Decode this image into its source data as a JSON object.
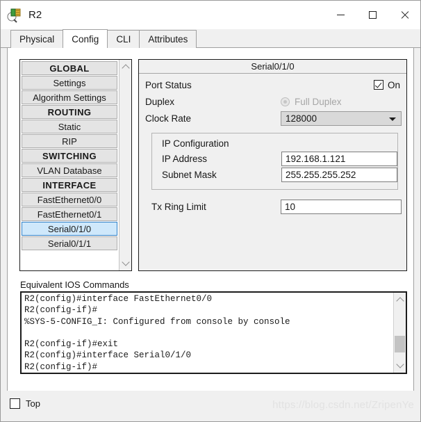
{
  "window": {
    "title": "R2",
    "icon": "packet-tracer-router-icon",
    "controls": {
      "minimize": "—",
      "maximize": "□",
      "close": "✕"
    }
  },
  "tabs": [
    {
      "label": "Physical",
      "active": false
    },
    {
      "label": "Config",
      "active": true
    },
    {
      "label": "CLI",
      "active": false
    },
    {
      "label": "Attributes",
      "active": false
    }
  ],
  "sidebar": {
    "items": [
      {
        "label": "GLOBAL",
        "type": "header"
      },
      {
        "label": "Settings",
        "type": "item"
      },
      {
        "label": "Algorithm Settings",
        "type": "item"
      },
      {
        "label": "ROUTING",
        "type": "header"
      },
      {
        "label": "Static",
        "type": "item"
      },
      {
        "label": "RIP",
        "type": "item"
      },
      {
        "label": "SWITCHING",
        "type": "header"
      },
      {
        "label": "VLAN Database",
        "type": "item"
      },
      {
        "label": "INTERFACE",
        "type": "header"
      },
      {
        "label": "FastEthernet0/0",
        "type": "item"
      },
      {
        "label": "FastEthernet0/1",
        "type": "item"
      },
      {
        "label": "Serial0/1/0",
        "type": "item",
        "selected": true
      },
      {
        "label": "Serial0/1/1",
        "type": "item"
      }
    ]
  },
  "config": {
    "panel_title": "Serial0/1/0",
    "port_status": {
      "label": "Port Status",
      "value_label": "On",
      "checked": true
    },
    "duplex": {
      "label": "Duplex",
      "option_label": "Full Duplex",
      "selected": true,
      "disabled": true
    },
    "clock_rate": {
      "label": "Clock Rate",
      "value": "128000"
    },
    "ip_configuration": {
      "title": "IP Configuration",
      "ip_address": {
        "label": "IP Address",
        "value": "192.168.1.121"
      },
      "subnet_mask": {
        "label": "Subnet Mask",
        "value": "255.255.255.252"
      }
    },
    "tx_ring_limit": {
      "label": "Tx Ring Limit",
      "value": "10"
    }
  },
  "ios": {
    "label": "Equivalent IOS Commands",
    "text": "R2(config)#interface FastEthernet0/0\nR2(config-if)#\n%SYS-5-CONFIG_I: Configured from console by console\n\nR2(config-if)#exit\nR2(config)#interface Serial0/1/0\nR2(config-if)#"
  },
  "footer": {
    "top_checkbox": {
      "label": "Top",
      "checked": false
    },
    "watermark": "https://blog.csdn.net/ZripenYe"
  },
  "colors": {
    "selection_bg": "#cfe8fb",
    "selection_border": "#2f80c7",
    "window_bg": "#f0f0f0",
    "item_bg": "#e4e4e4"
  }
}
